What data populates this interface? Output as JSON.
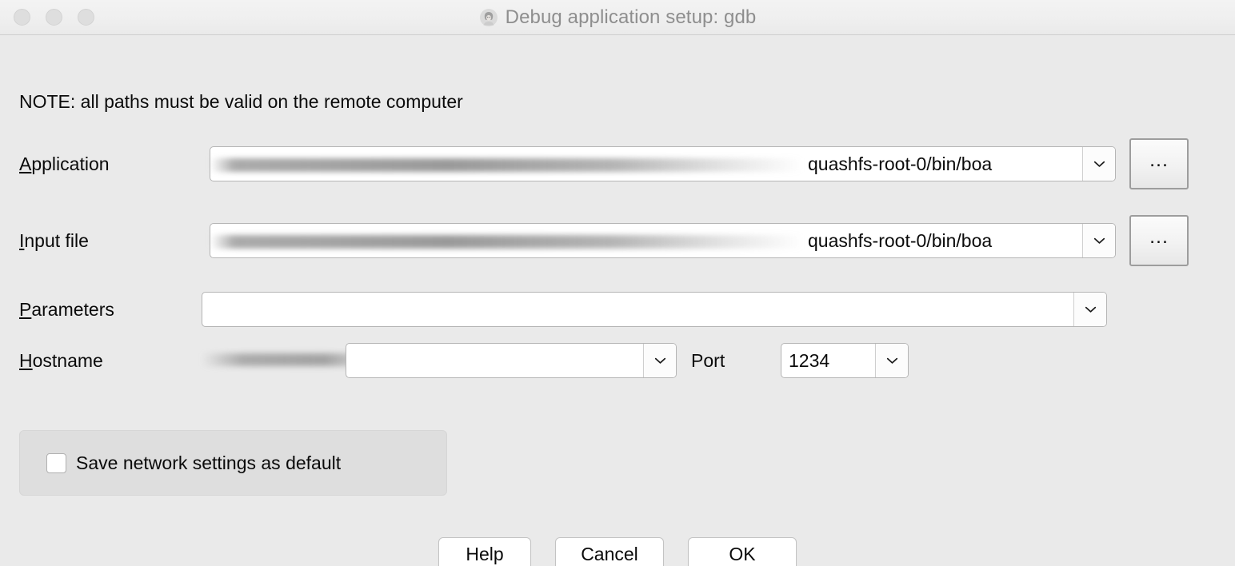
{
  "window": {
    "title": "Debug application setup: gdb",
    "title_icon": "debugger-avatar-icon",
    "traffic_lights": [
      "close-button",
      "minimize-button",
      "zoom-button"
    ]
  },
  "note": "NOTE: all paths must be valid on the remote computer",
  "form": {
    "application": {
      "label_prefix": "A",
      "label_rest": "pplication",
      "value_visible": "quashfs-root-0/bin/boa",
      "value_redacted": true,
      "browse_label": "...",
      "dropdown_icon": "chevron-down-icon"
    },
    "input_file": {
      "label_prefix": "I",
      "label_rest": "nput file",
      "value_visible": "quashfs-root-0/bin/boa",
      "value_redacted": true,
      "browse_label": "...",
      "dropdown_icon": "chevron-down-icon"
    },
    "parameters": {
      "label_prefix": "P",
      "label_rest": "arameters",
      "value": "",
      "placeholder": "",
      "dropdown_icon": "chevron-down-icon"
    },
    "hostname": {
      "label_prefix": "H",
      "label_rest": "ostname",
      "value": "",
      "value_redacted": true,
      "dropdown_icon": "chevron-down-icon"
    },
    "port": {
      "label_before": "Po",
      "label_mnemonic": "r",
      "label_after": "t",
      "value": "1234",
      "dropdown_icon": "chevron-down-icon"
    }
  },
  "options": {
    "save_network_settings": {
      "label": "Save network settings as default",
      "checked": false
    }
  },
  "buttons": {
    "help": "Help",
    "cancel": "Cancel",
    "ok": "OK"
  },
  "colors": {
    "window_background": "#eaeaea",
    "titlebar_background": "#f1f1f1",
    "title_text": "#8e8e8e",
    "text": "#0a0a0a",
    "field_background": "#ffffff",
    "field_border": "#b5b5b5",
    "groupbox_background": "#dedede",
    "button_background": "#ffffff"
  }
}
